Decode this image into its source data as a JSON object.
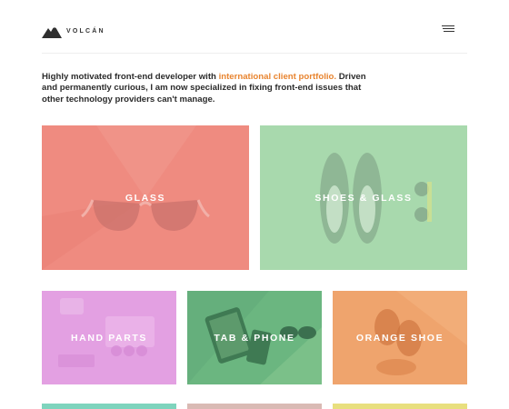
{
  "brand": {
    "name": "VOLCÁN"
  },
  "menu": {
    "icon": "hamburger-menu-icon"
  },
  "intro": {
    "text_before": "Highly motivated front-end developer with ",
    "link": "international client portfolio.",
    "text_after": " Driven and permanently curious, I am now specialized in fixing front-end issues that other technology providers can't manage."
  },
  "tiles": [
    {
      "label": "GLASS",
      "color": "#ef8b80"
    },
    {
      "label": "SHOES & GLASS",
      "color": "#a8d9ad"
    },
    {
      "label": "HAND PARTS",
      "color": "#e3a0e2"
    },
    {
      "label": "TAB & PHONE",
      "color": "#6bb680"
    },
    {
      "label": "ORANGE SHOE",
      "color": "#efa46d"
    }
  ],
  "colors": {
    "accent": "#e8842f",
    "text": "#2b2b2b"
  }
}
